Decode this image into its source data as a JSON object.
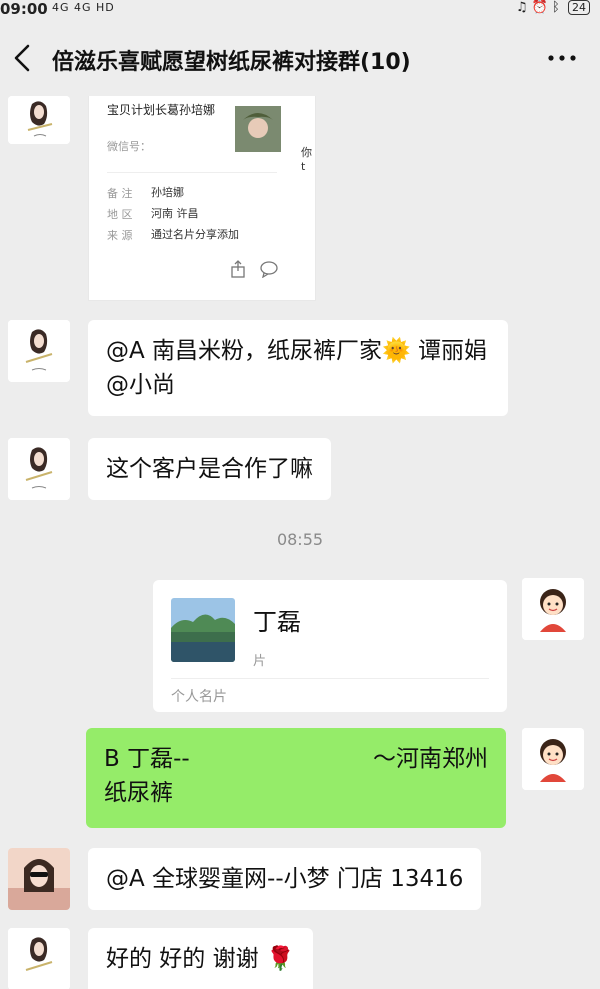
{
  "status_bar": {
    "time": "09:00",
    "signals": "4G 4G HD",
    "battery": "24"
  },
  "header": {
    "title": "倍滋乐喜赋愿望树纸尿裤对接群(10)"
  },
  "messages": {
    "m1": {
      "contact_name": "宝贝计划长葛孙培娜",
      "wechat_id_label": "微信号：",
      "remark_label": "备 注",
      "remark_value": "孙培娜",
      "region_label": "地 区",
      "region_value": "河南 许昌",
      "source_label": "来 源",
      "source_value": "通过名片分享添加",
      "side_text": "你t"
    },
    "m2": {
      "text_a": "@A 南昌米粉，纸尿裤厂家",
      "emoji": "🌞",
      "text_b": " 谭丽娟 @小尚"
    },
    "m3": {
      "text": "这个客户是合作了嘛"
    },
    "timestamp": "08:55",
    "m4": {
      "name": "丁磊",
      "sub": "片",
      "footer": "个人名片"
    },
    "m5": {
      "line1_a": "B 丁磊--",
      "line1_b": "～河南郑州",
      "line2": "纸尿裤"
    },
    "m6": {
      "text": "@A 全球婴童网--小梦  门店 13416"
    },
    "m7": {
      "text": "好的 好的 谢谢 ",
      "emoji": "🌹"
    }
  },
  "colors": {
    "background": "#ededed",
    "bubble_white": "#ffffff",
    "bubble_green": "#95ec69"
  }
}
